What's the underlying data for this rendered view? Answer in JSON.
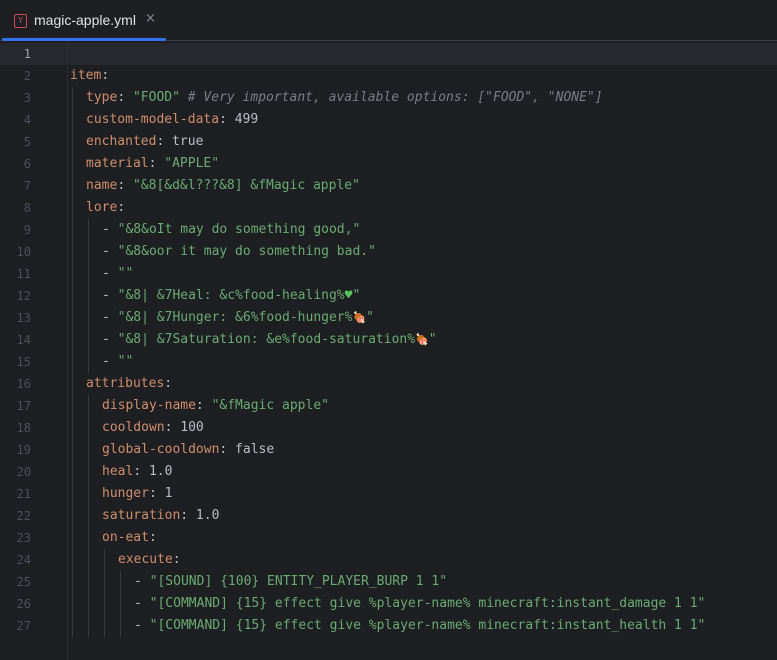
{
  "tab": {
    "filename": "magic-apple.yml",
    "icon": "yaml-file-icon",
    "icon_letter": "Y",
    "close_glyph": "×"
  },
  "editor": {
    "current_line": 1,
    "colors": {
      "key": "#cf8e6d",
      "string": "#6aab73",
      "plain": "#bcbec4",
      "comment": "#7a7e85",
      "line_number": "#4b5059",
      "accent": "#3574f0"
    },
    "lines": [
      {
        "num": "1",
        "indent": 0,
        "tokens": []
      },
      {
        "num": "2",
        "indent": 0,
        "tokens": [
          {
            "t": "k",
            "v": "item"
          },
          {
            "t": "n",
            "v": ":"
          }
        ]
      },
      {
        "num": "3",
        "indent": 1,
        "tokens": [
          {
            "t": "k",
            "v": "type"
          },
          {
            "t": "n",
            "v": ": "
          },
          {
            "t": "s",
            "v": "\"FOOD\""
          },
          {
            "t": "c",
            "v": " # Very important, available options: [\"FOOD\", \"NONE\"]"
          }
        ]
      },
      {
        "num": "4",
        "indent": 1,
        "tokens": [
          {
            "t": "k",
            "v": "custom-model-data"
          },
          {
            "t": "n",
            "v": ": 499"
          }
        ]
      },
      {
        "num": "5",
        "indent": 1,
        "tokens": [
          {
            "t": "k",
            "v": "enchanted"
          },
          {
            "t": "n",
            "v": ": true"
          }
        ]
      },
      {
        "num": "6",
        "indent": 1,
        "tokens": [
          {
            "t": "k",
            "v": "material"
          },
          {
            "t": "n",
            "v": ": "
          },
          {
            "t": "s",
            "v": "\"APPLE\""
          }
        ]
      },
      {
        "num": "7",
        "indent": 1,
        "tokens": [
          {
            "t": "k",
            "v": "name"
          },
          {
            "t": "n",
            "v": ": "
          },
          {
            "t": "s",
            "v": "\"&8[&d&l???&8] &fMagic apple\""
          }
        ]
      },
      {
        "num": "8",
        "indent": 1,
        "tokens": [
          {
            "t": "k",
            "v": "lore"
          },
          {
            "t": "n",
            "v": ":"
          }
        ]
      },
      {
        "num": "9",
        "indent": 2,
        "tokens": [
          {
            "t": "n",
            "v": "- "
          },
          {
            "t": "s",
            "v": "\"&8&oIt may do something good,\""
          }
        ]
      },
      {
        "num": "10",
        "indent": 2,
        "tokens": [
          {
            "t": "n",
            "v": "- "
          },
          {
            "t": "s",
            "v": "\"&8&oor it may do something bad.\""
          }
        ]
      },
      {
        "num": "11",
        "indent": 2,
        "tokens": [
          {
            "t": "n",
            "v": "- "
          },
          {
            "t": "s",
            "v": "\"\""
          }
        ]
      },
      {
        "num": "12",
        "indent": 2,
        "tokens": [
          {
            "t": "n",
            "v": "- "
          },
          {
            "t": "s",
            "v": "\"&8| &7Heal: &c%food-healing%"
          },
          {
            "t": "heart",
            "v": "♥"
          },
          {
            "t": "s",
            "v": "\""
          }
        ]
      },
      {
        "num": "13",
        "indent": 2,
        "tokens": [
          {
            "t": "n",
            "v": "- "
          },
          {
            "t": "s",
            "v": "\"&8| &7Hunger: &6%food-hunger%"
          },
          {
            "t": "em",
            "v": "🍖"
          },
          {
            "t": "s",
            "v": "\""
          }
        ]
      },
      {
        "num": "14",
        "indent": 2,
        "tokens": [
          {
            "t": "n",
            "v": "- "
          },
          {
            "t": "s",
            "v": "\"&8| &7Saturation: &e%food-saturation%"
          },
          {
            "t": "em",
            "v": "🍖"
          },
          {
            "t": "s",
            "v": "\""
          }
        ]
      },
      {
        "num": "15",
        "indent": 2,
        "tokens": [
          {
            "t": "n",
            "v": "- "
          },
          {
            "t": "s",
            "v": "\"\""
          }
        ]
      },
      {
        "num": "16",
        "indent": 1,
        "tokens": [
          {
            "t": "k",
            "v": "attributes"
          },
          {
            "t": "n",
            "v": ":"
          }
        ]
      },
      {
        "num": "17",
        "indent": 2,
        "tokens": [
          {
            "t": "k",
            "v": "display-name"
          },
          {
            "t": "n",
            "v": ": "
          },
          {
            "t": "s",
            "v": "\"&fMagic apple\""
          }
        ]
      },
      {
        "num": "18",
        "indent": 2,
        "tokens": [
          {
            "t": "k",
            "v": "cooldown"
          },
          {
            "t": "n",
            "v": ": 100"
          }
        ]
      },
      {
        "num": "19",
        "indent": 2,
        "tokens": [
          {
            "t": "k",
            "v": "global-cooldown"
          },
          {
            "t": "n",
            "v": ": false"
          }
        ]
      },
      {
        "num": "20",
        "indent": 2,
        "tokens": [
          {
            "t": "k",
            "v": "heal"
          },
          {
            "t": "n",
            "v": ": 1.0"
          }
        ]
      },
      {
        "num": "21",
        "indent": 2,
        "tokens": [
          {
            "t": "k",
            "v": "hunger"
          },
          {
            "t": "n",
            "v": ": 1"
          }
        ]
      },
      {
        "num": "22",
        "indent": 2,
        "tokens": [
          {
            "t": "k",
            "v": "saturation"
          },
          {
            "t": "n",
            "v": ": 1.0"
          }
        ]
      },
      {
        "num": "23",
        "indent": 2,
        "tokens": [
          {
            "t": "k",
            "v": "on-eat"
          },
          {
            "t": "n",
            "v": ":"
          }
        ]
      },
      {
        "num": "24",
        "indent": 3,
        "tokens": [
          {
            "t": "k",
            "v": "execute"
          },
          {
            "t": "n",
            "v": ":"
          }
        ]
      },
      {
        "num": "25",
        "indent": 4,
        "tokens": [
          {
            "t": "n",
            "v": "- "
          },
          {
            "t": "s",
            "v": "\"[SOUND] {100} ENTITY_PLAYER_BURP 1 1\""
          }
        ]
      },
      {
        "num": "26",
        "indent": 4,
        "tokens": [
          {
            "t": "n",
            "v": "- "
          },
          {
            "t": "s",
            "v": "\"[COMMAND] {15} effect give %player-name% minecraft:instant_damage 1 1\""
          }
        ]
      },
      {
        "num": "27",
        "indent": 4,
        "tokens": [
          {
            "t": "n",
            "v": "- "
          },
          {
            "t": "s",
            "v": "\"[COMMAND] {15} effect give %player-name% minecraft:instant_health 1 1\""
          }
        ]
      }
    ]
  }
}
